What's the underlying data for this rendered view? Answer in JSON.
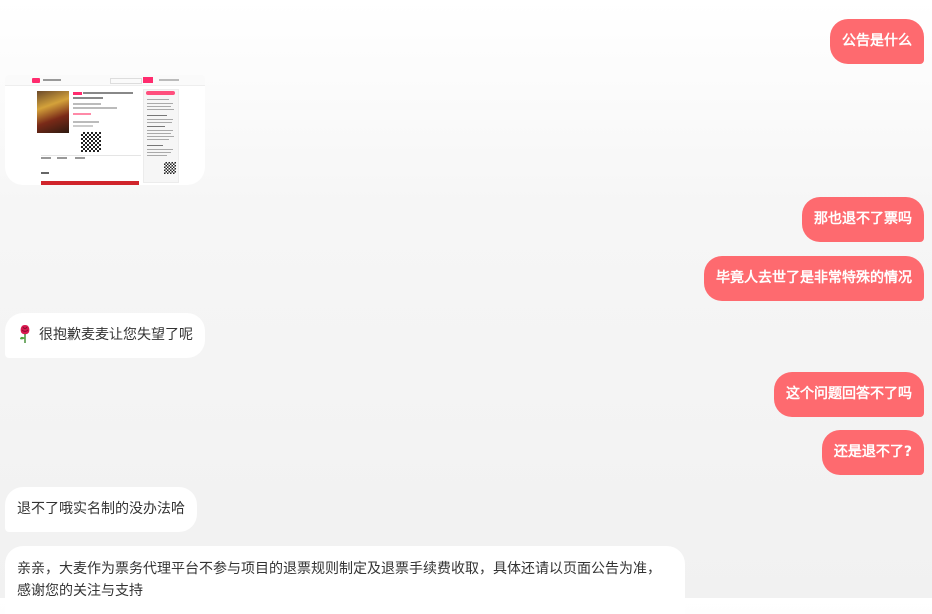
{
  "conversation": {
    "msg1": "公告是什么",
    "msg2": "那也退不了票吗",
    "msg3": "毕竟人去世了是非常特殊的情况",
    "msg4": "很抱歉麦麦让您失望了呢",
    "msg5": "这个问题回答不了吗",
    "msg6": "还是退不了?",
    "msg7": "退不了哦实名制的没办法哈",
    "msg8": "亲亲，大麦作为票务代理平台不参与项目的退票规则制定及退票手续费收取，具体还请以页面公告为准，感谢您的关注与支持"
  },
  "icons": {
    "msg4_icon": "rose-icon"
  },
  "colors": {
    "outgoing_bubble": "#fe6a6f",
    "incoming_bubble": "#ffffff",
    "brand_pink": "#ff2c6e"
  }
}
